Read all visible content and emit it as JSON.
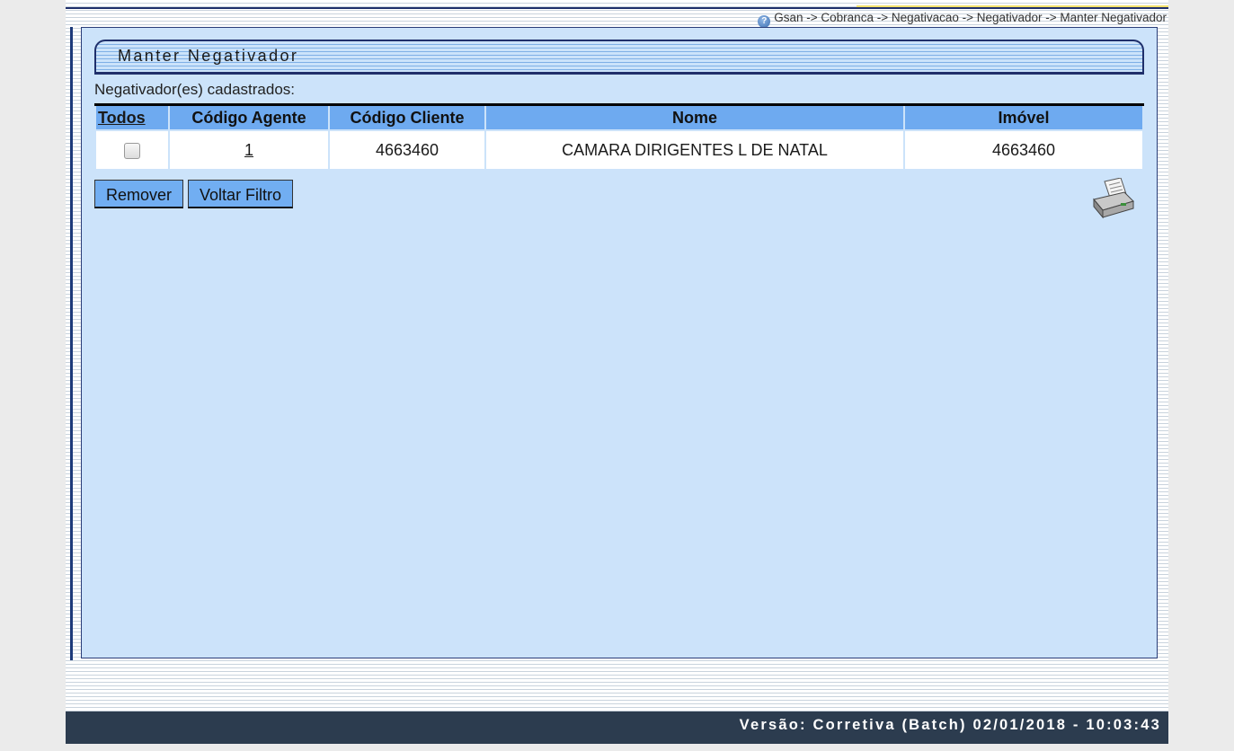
{
  "breadcrumb": "Gsan -> Cobranca -> Negativacao -> Negativador -> Manter Negativador",
  "panel": {
    "title": "Manter Negativador",
    "subtitle": "Negativador(es) cadastrados:"
  },
  "table": {
    "headers": {
      "todos": "Todos",
      "codigo_agente": "Código Agente",
      "codigo_cliente": "Código Cliente",
      "nome": "Nome",
      "imovel": "Imóvel"
    },
    "rows": [
      {
        "codigo_agente": "1",
        "codigo_cliente": "4663460",
        "nome": "CAMARA DIRIGENTES L DE NATAL",
        "imovel": "4663460"
      }
    ]
  },
  "buttons": {
    "remover": "Remover",
    "voltar_filtro": "Voltar Filtro"
  },
  "icons": {
    "help": "help-icon",
    "printer": "printer-icon"
  },
  "footer": "Versão: Corretiva (Batch) 02/01/2018 - 10:03:43",
  "colors": {
    "panel_bg": "#cce3fa",
    "header_bg": "#6eaaf0",
    "button_bg": "#71aef2",
    "footer_bg": "#2c3c4f"
  }
}
